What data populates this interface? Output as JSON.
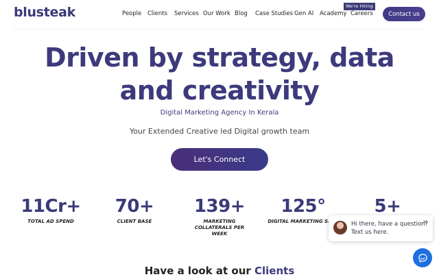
{
  "header": {
    "logo": "blusteak",
    "nav": [
      "People",
      "Clients",
      "Services",
      "Our Work",
      "Blog",
      "Case Studies",
      "Gen AI",
      "Academy",
      "Careers"
    ],
    "hiring_badge": "We're Hiring",
    "contact_label": "Contact us"
  },
  "hero": {
    "title_line1": "Driven by strategy, data",
    "title_line2": "and creativity",
    "subtitle": "Digital Marketing Agency In Kerala",
    "tagline": "Your Extended Creative led Digital growth team",
    "cta_label": "Let's Connect"
  },
  "stats": [
    {
      "value": "11Cr+",
      "label": "TOTAL AD SPEND"
    },
    {
      "value": "70+",
      "label": "CLIENT BASE"
    },
    {
      "value": "139+",
      "label": "MARKETING COLLATERALS PER WEEK"
    },
    {
      "value": "125°",
      "label": "DIGITAL MARKETING SERV"
    },
    {
      "value": "5+",
      "label": ""
    }
  ],
  "clients_section": {
    "heading_prefix": "Have a look at our",
    "heading_accent": "Clients"
  },
  "chat": {
    "line1": "Hi there, have a question?",
    "line2": "Text us here.",
    "close_icon": "close-icon",
    "fab_icon": "chat-bubble-icon"
  },
  "colors": {
    "brand": "#3a3a78",
    "cta_gradient_start": "#4a2f78",
    "cta_gradient_end": "#3a3a8a",
    "chat_blue": "#1f6fe0"
  }
}
